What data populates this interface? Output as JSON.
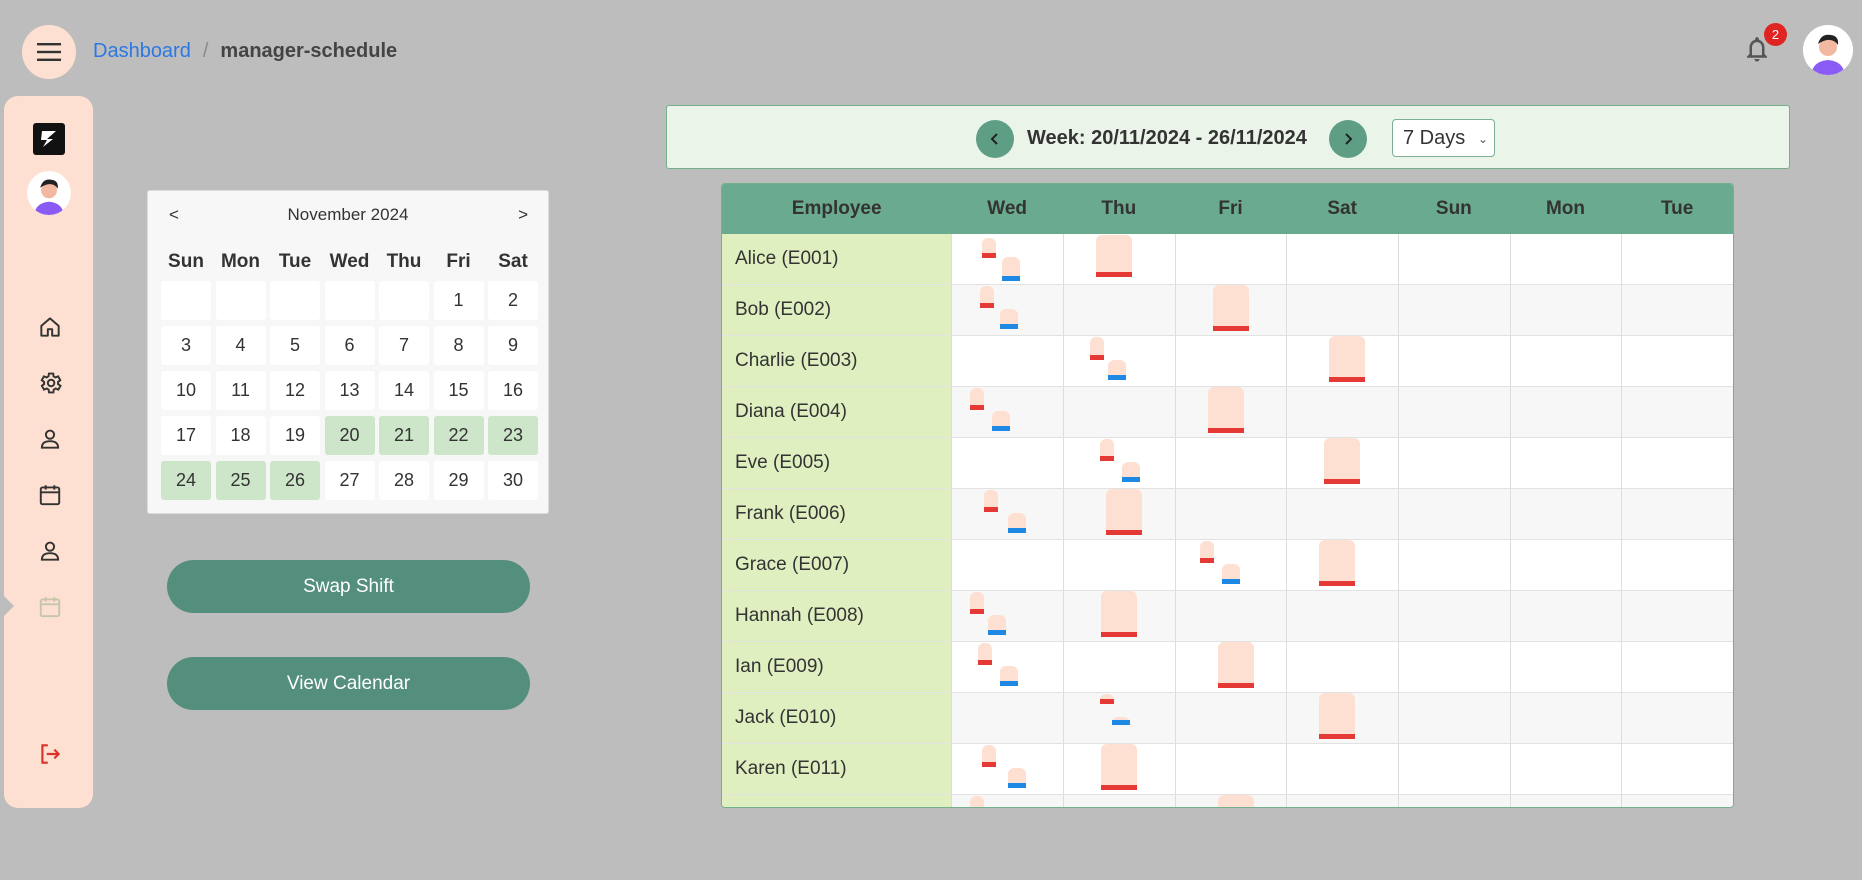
{
  "header": {
    "breadcrumb_root": "Dashboard",
    "breadcrumb_sep": "/",
    "breadcrumb_current": "manager-schedule",
    "notification_count": "2",
    "menu_icon": "hamburger-icon",
    "bell_icon": "bell-icon"
  },
  "sidebar": {
    "items": [
      {
        "icon": "home-icon"
      },
      {
        "icon": "gear-icon"
      },
      {
        "icon": "user-icon"
      },
      {
        "icon": "calendar-icon"
      },
      {
        "icon": "user-icon"
      },
      {
        "icon": "calendar-icon",
        "active": true
      },
      {
        "icon": "logout-icon"
      }
    ]
  },
  "mini_calendar": {
    "prev": "<",
    "next": ">",
    "title": "November 2024",
    "weekdays": [
      "Sun",
      "Mon",
      "Tue",
      "Wed",
      "Thu",
      "Fri",
      "Sat"
    ],
    "days": [
      "",
      "",
      "",
      "",
      "",
      "1",
      "2",
      "3",
      "4",
      "5",
      "6",
      "7",
      "8",
      "9",
      "10",
      "11",
      "12",
      "13",
      "14",
      "15",
      "16",
      "17",
      "18",
      "19",
      "20",
      "21",
      "22",
      "23",
      "24",
      "25",
      "26",
      "27",
      "28",
      "29",
      "30"
    ],
    "highlighted": [
      "20",
      "21",
      "22",
      "23",
      "24",
      "25",
      "26"
    ]
  },
  "actions": {
    "swap_shift": "Swap Shift",
    "view_calendar": "View Calendar"
  },
  "week": {
    "label": "Week: 20/11/2024 - 26/11/2024",
    "range_select": "7 Days"
  },
  "schedule": {
    "employee_header": "Employee",
    "days": [
      "Wed",
      "Thu",
      "Fri",
      "Sat",
      "Sun",
      "Mon",
      "Tue"
    ],
    "employees": [
      {
        "name": "Alice (E001)"
      },
      {
        "name": "Bob (E002)"
      },
      {
        "name": "Charlie (E003)"
      },
      {
        "name": "Diana (E004)"
      },
      {
        "name": "Eve (E005)"
      },
      {
        "name": "Frank (E006)"
      },
      {
        "name": "Grace (E007)"
      },
      {
        "name": "Hannah (E008)"
      },
      {
        "name": "Ian (E009)"
      },
      {
        "name": "Jack (E010)"
      },
      {
        "name": "Karen (E011)"
      },
      {
        "name": ""
      }
    ]
  },
  "colors": {
    "shift_fill": "#fde0d2",
    "shift_red": "#e53935",
    "shift_blue": "#1e88e5",
    "header_green": "#6aaa8e",
    "button_green": "#548f7e"
  }
}
